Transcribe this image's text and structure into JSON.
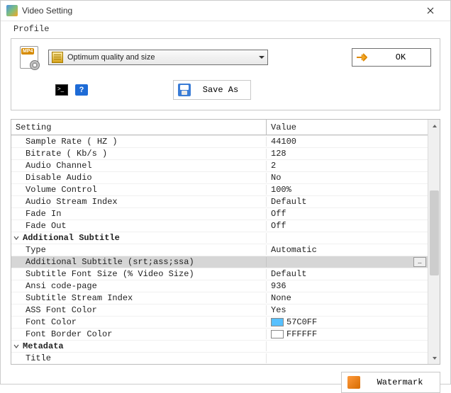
{
  "window": {
    "title": "Video Setting"
  },
  "profile": {
    "label": "Profile",
    "dropdown_value": "Optimum quality and size",
    "ok_label": "OK",
    "save_as_label": "Save As"
  },
  "grid": {
    "header_setting": "Setting",
    "header_value": "Value",
    "rows": [
      {
        "type": "item",
        "label": "Sample Rate ( HZ )",
        "value": "44100"
      },
      {
        "type": "item",
        "label": "Bitrate ( Kb/s )",
        "value": "128"
      },
      {
        "type": "item",
        "label": "Audio Channel",
        "value": "2"
      },
      {
        "type": "item",
        "label": "Disable Audio",
        "value": "No"
      },
      {
        "type": "item",
        "label": "Volume Control",
        "value": "100%"
      },
      {
        "type": "item",
        "label": "Audio Stream Index",
        "value": "Default"
      },
      {
        "type": "item",
        "label": "Fade In",
        "value": "Off"
      },
      {
        "type": "item",
        "label": "Fade Out",
        "value": "Off"
      },
      {
        "type": "group",
        "label": "Additional Subtitle"
      },
      {
        "type": "item",
        "label": "Type",
        "value": "Automatic"
      },
      {
        "type": "item",
        "label": "Additional Subtitle (srt;ass;ssa)",
        "value": "",
        "selected": true,
        "browse": true
      },
      {
        "type": "item",
        "label": "Subtitle Font Size (% Video Size)",
        "value": "Default"
      },
      {
        "type": "item",
        "label": "Ansi code-page",
        "value": "936"
      },
      {
        "type": "item",
        "label": "Subtitle Stream Index",
        "value": "None"
      },
      {
        "type": "item",
        "label": "ASS Font Color",
        "value": "Yes"
      },
      {
        "type": "item",
        "label": "Font Color",
        "value": "57C0FF",
        "swatch": "#57C0FF"
      },
      {
        "type": "item",
        "label": "Font Border Color",
        "value": "FFFFFF",
        "swatch": "#FFFFFF"
      },
      {
        "type": "group",
        "label": "Metadata"
      },
      {
        "type": "item",
        "label": "Title",
        "value": ""
      }
    ]
  },
  "footer": {
    "watermark_label": "Watermark"
  }
}
